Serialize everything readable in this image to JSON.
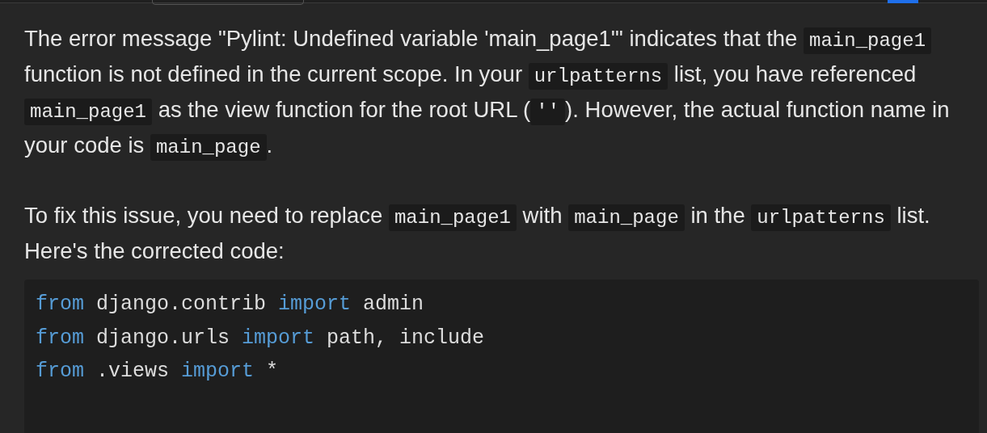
{
  "paragraphs": [
    {
      "parts": [
        {
          "kind": "text",
          "text": "The error message \"Pylint: Undefined variable 'main_page1'\" indicates that the "
        },
        {
          "kind": "code",
          "text": "main_page1"
        },
        {
          "kind": "text",
          "text": " function is not defined in the current scope. In your "
        },
        {
          "kind": "code",
          "text": "urlpatterns"
        },
        {
          "kind": "text",
          "text": " list, you have referenced "
        },
        {
          "kind": "code",
          "text": "main_page1"
        },
        {
          "kind": "text",
          "text": " as the view function for the root URL ("
        },
        {
          "kind": "code",
          "text": "''"
        },
        {
          "kind": "text",
          "text": "). However, the actual function name in your code is "
        },
        {
          "kind": "code",
          "text": "main_page"
        },
        {
          "kind": "text",
          "text": "."
        }
      ]
    },
    {
      "parts": [
        {
          "kind": "text",
          "text": "To fix this issue, you need to replace "
        },
        {
          "kind": "code",
          "text": "main_page1"
        },
        {
          "kind": "text",
          "text": " with "
        },
        {
          "kind": "code",
          "text": "main_page"
        },
        {
          "kind": "text",
          "text": " in the "
        },
        {
          "kind": "code",
          "text": "urlpatterns"
        },
        {
          "kind": "text",
          "text": " list. Here's the corrected code:"
        }
      ]
    }
  ],
  "code_block": {
    "lines": [
      [
        {
          "kind": "keyword",
          "text": "from"
        },
        {
          "kind": "plain",
          "text": " django.contrib "
        },
        {
          "kind": "keyword",
          "text": "import"
        },
        {
          "kind": "plain",
          "text": " admin"
        }
      ],
      [
        {
          "kind": "keyword",
          "text": "from"
        },
        {
          "kind": "plain",
          "text": " django.urls "
        },
        {
          "kind": "keyword",
          "text": "import"
        },
        {
          "kind": "plain",
          "text": " path, include"
        }
      ],
      [
        {
          "kind": "keyword",
          "text": "from"
        },
        {
          "kind": "plain",
          "text": " .views "
        },
        {
          "kind": "keyword",
          "text": "import"
        },
        {
          "kind": "plain",
          "text": " *"
        }
      ]
    ]
  }
}
